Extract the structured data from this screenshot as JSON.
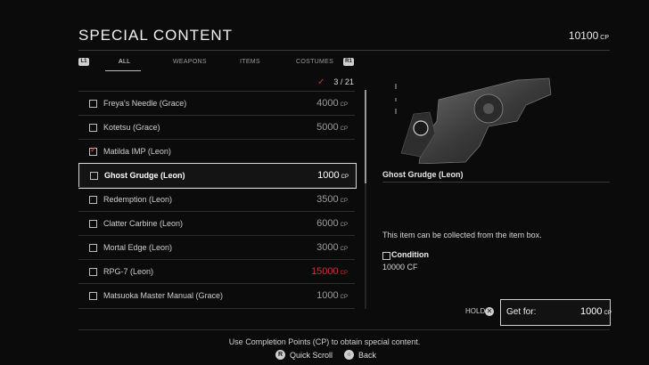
{
  "header": {
    "title": "SPECIAL CONTENT",
    "cp_total": "10100",
    "cp_unit": "CP"
  },
  "tabs": {
    "left_button": "L1",
    "right_button": "R1",
    "items": [
      {
        "label": "ALL",
        "active": true
      },
      {
        "label": "WEAPONS",
        "active": false
      },
      {
        "label": "ITEMS",
        "active": false
      },
      {
        "label": "COSTUMES",
        "active": false
      }
    ]
  },
  "counter": {
    "check": "✓",
    "value": "3 / 21"
  },
  "list": {
    "unit": "CP",
    "items": [
      {
        "name": "Freya's Needle (Grace)",
        "price": "4000",
        "checked": false,
        "selected": false,
        "unaffordable": false
      },
      {
        "name": "Kotetsu (Grace)",
        "price": "5000",
        "checked": false,
        "selected": false,
        "unaffordable": false
      },
      {
        "name": "Matilda IMP (Leon)",
        "price": "",
        "checked": true,
        "selected": false,
        "unaffordable": false
      },
      {
        "name": "Ghost Grudge (Leon)",
        "price": "1000",
        "checked": false,
        "selected": true,
        "unaffordable": false
      },
      {
        "name": "Redemption (Leon)",
        "price": "3500",
        "checked": false,
        "selected": false,
        "unaffordable": false
      },
      {
        "name": "Clatter Carbine (Leon)",
        "price": "6000",
        "checked": false,
        "selected": false,
        "unaffordable": false
      },
      {
        "name": "Mortal Edge (Leon)",
        "price": "3000",
        "checked": false,
        "selected": false,
        "unaffordable": false
      },
      {
        "name": "RPG-7 (Leon)",
        "price": "15000",
        "checked": false,
        "selected": false,
        "unaffordable": true
      },
      {
        "name": "Matsuoka Master Manual (Grace)",
        "price": "1000",
        "checked": false,
        "selected": false,
        "unaffordable": false
      }
    ]
  },
  "detail": {
    "item_name": "Ghost Grudge (Leon)",
    "description_lines": [
      "",
      "",
      ""
    ],
    "collect_note": "This item can be collected from the item box.",
    "condition_label": "Condition",
    "condition_value": "10000 CF",
    "hold_label": "HOLD",
    "hold_button": "✕",
    "get_label": "Get for:",
    "get_price": "1000",
    "get_unit": "CP"
  },
  "footer": {
    "hint": "Use Completion Points (CP) to obtain special content.",
    "actions": [
      {
        "button": "R",
        "label": "Quick Scroll"
      },
      {
        "button": "○",
        "label": "Back"
      }
    ]
  }
}
